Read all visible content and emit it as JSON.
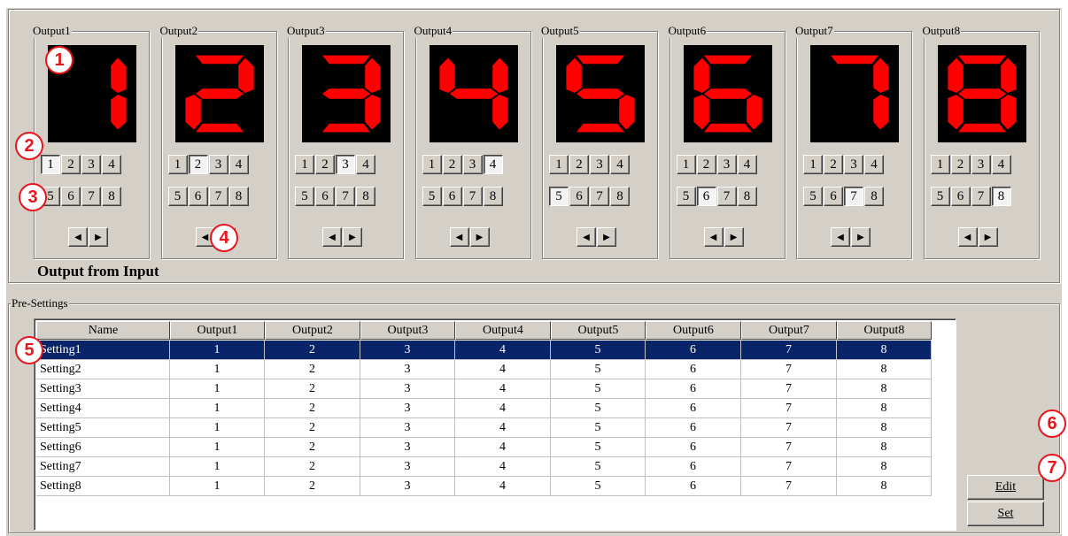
{
  "outputs": [
    {
      "title": "Output1",
      "digit": "1",
      "selected": 1,
      "row1": [
        "1",
        "2",
        "3",
        "4"
      ],
      "row2": [
        "5",
        "6",
        "7",
        "8"
      ]
    },
    {
      "title": "Output2",
      "digit": "2",
      "selected": 2,
      "row1": [
        "1",
        "2",
        "3",
        "4"
      ],
      "row2": [
        "5",
        "6",
        "7",
        "8"
      ]
    },
    {
      "title": "Output3",
      "digit": "3",
      "selected": 3,
      "row1": [
        "1",
        "2",
        "3",
        "4"
      ],
      "row2": [
        "5",
        "6",
        "7",
        "8"
      ]
    },
    {
      "title": "Output4",
      "digit": "4",
      "selected": 4,
      "row1": [
        "1",
        "2",
        "3",
        "4"
      ],
      "row2": [
        "5",
        "6",
        "7",
        "8"
      ]
    },
    {
      "title": "Output5",
      "digit": "5",
      "selected": 5,
      "row1": [
        "1",
        "2",
        "3",
        "4"
      ],
      "row2": [
        "5",
        "6",
        "7",
        "8"
      ]
    },
    {
      "title": "Output6",
      "digit": "6",
      "selected": 6,
      "row1": [
        "1",
        "2",
        "3",
        "4"
      ],
      "row2": [
        "5",
        "6",
        "7",
        "8"
      ]
    },
    {
      "title": "Output7",
      "digit": "7",
      "selected": 7,
      "row1": [
        "1",
        "2",
        "3",
        "4"
      ],
      "row2": [
        "5",
        "6",
        "7",
        "8"
      ]
    },
    {
      "title": "Output8",
      "digit": "8",
      "selected": 8,
      "row1": [
        "1",
        "2",
        "3",
        "4"
      ],
      "row2": [
        "5",
        "6",
        "7",
        "8"
      ]
    }
  ],
  "arrows": {
    "left": "◀",
    "right": "▶"
  },
  "output_from_input_label": "Output from Input",
  "presettings": {
    "title": "Pre-Settings",
    "columns": [
      "Name",
      "Output1",
      "Output2",
      "Output3",
      "Output4",
      "Output5",
      "Output6",
      "Output7",
      "Output8"
    ],
    "rows": [
      [
        "Setting1",
        "1",
        "2",
        "3",
        "4",
        "5",
        "6",
        "7",
        "8"
      ],
      [
        "Setting2",
        "1",
        "2",
        "3",
        "4",
        "5",
        "6",
        "7",
        "8"
      ],
      [
        "Setting3",
        "1",
        "2",
        "3",
        "4",
        "5",
        "6",
        "7",
        "8"
      ],
      [
        "Setting4",
        "1",
        "2",
        "3",
        "4",
        "5",
        "6",
        "7",
        "8"
      ],
      [
        "Setting5",
        "1",
        "2",
        "3",
        "4",
        "5",
        "6",
        "7",
        "8"
      ],
      [
        "Setting6",
        "1",
        "2",
        "3",
        "4",
        "5",
        "6",
        "7",
        "8"
      ],
      [
        "Setting7",
        "1",
        "2",
        "3",
        "4",
        "5",
        "6",
        "7",
        "8"
      ],
      [
        "Setting8",
        "1",
        "2",
        "3",
        "4",
        "5",
        "6",
        "7",
        "8"
      ]
    ],
    "selected_row": 0,
    "edit_label": "Edit",
    "set_label": "Set"
  },
  "callouts": [
    "1",
    "2",
    "3",
    "4",
    "5",
    "6",
    "7"
  ],
  "colors": {
    "segment_on": "#ff0000",
    "display_bg": "#000000",
    "selection": "#0a246a",
    "callout": "#e8161c"
  }
}
